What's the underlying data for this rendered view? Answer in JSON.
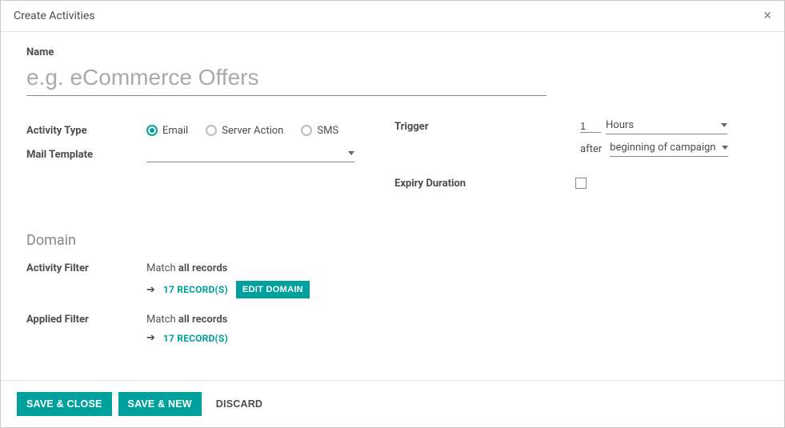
{
  "modal": {
    "title": "Create Activities"
  },
  "form": {
    "name_label": "Name",
    "name_placeholder": "e.g. eCommerce Offers",
    "name_value": "",
    "activity_type_label": "Activity Type",
    "activity_type_options": {
      "email": "Email",
      "server_action": "Server Action",
      "sms": "SMS"
    },
    "activity_type_selected": "email",
    "mail_template_label": "Mail Template",
    "mail_template_value": "",
    "trigger_label": "Trigger",
    "trigger_number": "1",
    "trigger_unit": "Hours",
    "trigger_after_text": "after",
    "trigger_event": "beginning of campaign",
    "expiry_label": "Expiry Duration",
    "expiry_checked": false
  },
  "domain": {
    "heading": "Domain",
    "activity_filter_label": "Activity Filter",
    "applied_filter_label": "Applied Filter",
    "match_prefix": "Match ",
    "match_bold": "all records",
    "records_link": "17 RECORD(S)",
    "edit_domain": "EDIT DOMAIN"
  },
  "footer": {
    "save_close": "SAVE & CLOSE",
    "save_new": "SAVE & NEW",
    "discard": "DISCARD"
  }
}
